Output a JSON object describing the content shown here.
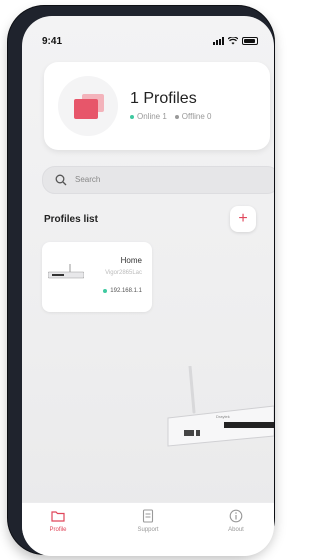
{
  "status_bar": {
    "time": "9:41"
  },
  "summary": {
    "title": "1 Profiles",
    "online_label": "Online 1",
    "offline_label": "Offline 0",
    "online_color": "#3fc9a0",
    "offline_color": "#9a9a9a"
  },
  "search": {
    "placeholder": "Search"
  },
  "profiles_list": {
    "title": "Profiles list",
    "add_label": "+",
    "items": [
      {
        "name": "Home",
        "model": "Vigor2865Lac",
        "ip": "192.168.1.1"
      }
    ]
  },
  "tabs": [
    {
      "label": "Profile",
      "icon": "folder-icon",
      "active": true
    },
    {
      "label": "Support",
      "icon": "document-icon",
      "active": false
    },
    {
      "label": "About",
      "icon": "info-icon",
      "active": false
    }
  ],
  "accent_color": "#e0465a"
}
